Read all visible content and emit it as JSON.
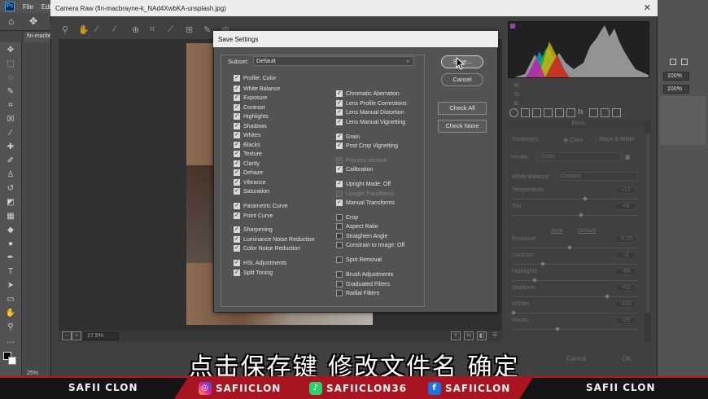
{
  "ps": {
    "menu": [
      "File",
      "Edit"
    ],
    "doc_tab": "fin-macbr",
    "zoom": "25%",
    "right_panel": {
      "zoom1": "100%",
      "zoom2": "100%"
    }
  },
  "camera_raw": {
    "title": "Camera Raw (fin-macbrayne-k_NAd4XwbKA-unsplash.jpg)",
    "zoom_select": "17.5%",
    "rgb_labels": [
      "R:",
      "G:",
      "B:"
    ],
    "panel_title": "Basic",
    "treatment_label": "Treatment:",
    "treatment_options": [
      "Color",
      "Black & White"
    ],
    "profile_label": "Profile:",
    "profile_value": "Color",
    "white_balance_label": "White Balance:",
    "white_balance_value": "Custom",
    "sliders": [
      {
        "label": "Temperature",
        "value": "+17",
        "level": 0.58
      },
      {
        "label": "Tint",
        "value": "+9",
        "level": 0.55
      },
      {
        "label": "Exposure",
        "value": "-0.25",
        "level": 0.46
      },
      {
        "label": "Contrast",
        "value": "-3",
        "level": 0.24
      },
      {
        "label": "Highlights",
        "value": "-66",
        "level": 0.17
      },
      {
        "label": "Shadows",
        "value": "+52",
        "level": 0.76
      },
      {
        "label": "Whites",
        "value": "-100",
        "level": 0.0
      },
      {
        "label": "Blacks",
        "value": "-29",
        "level": 0.36
      }
    ],
    "auto_label": "Auto",
    "default_label": "Default",
    "cancel_label": "Cancel",
    "ok_label": "OK"
  },
  "dialog": {
    "title": "Save Settings",
    "subset_label": "Subset:",
    "subset_value": "Default",
    "buttons": {
      "save": "Save...",
      "cancel": "Cancel",
      "check_all": "Check All",
      "check_none": "Check None"
    },
    "left_col": [
      {
        "label": "Profile: Color",
        "checked": true
      },
      {
        "label": "White Balance",
        "checked": true
      },
      {
        "label": "Exposure",
        "checked": true
      },
      {
        "label": "Contrast",
        "checked": true
      },
      {
        "label": "Highlights",
        "checked": true
      },
      {
        "label": "Shadows",
        "checked": true
      },
      {
        "label": "Whites",
        "checked": true
      },
      {
        "label": "Blacks",
        "checked": true
      },
      {
        "label": "Texture",
        "checked": true
      },
      {
        "label": "Clarity",
        "checked": true
      },
      {
        "label": "Dehaze",
        "checked": true
      },
      {
        "label": "Vibrance",
        "checked": true
      },
      {
        "label": "Saturation",
        "checked": true
      },
      {
        "label": "Parametric Curve",
        "checked": true
      },
      {
        "label": "Point Curve",
        "checked": true
      },
      {
        "label": "Sharpening",
        "checked": true
      },
      {
        "label": "Luminance Noise Reduction",
        "checked": true
      },
      {
        "label": "Color Noise Reduction",
        "checked": true
      },
      {
        "label": "HSL Adjustments",
        "checked": true
      },
      {
        "label": "Split Toning",
        "checked": true
      }
    ],
    "right_col": [
      {
        "label": "Chromatic Aberration",
        "checked": true,
        "disabled": false
      },
      {
        "label": "Lens Profile Corrections",
        "checked": true,
        "disabled": false
      },
      {
        "label": "Lens Manual Distortion",
        "checked": true,
        "disabled": false
      },
      {
        "label": "Lens Manual Vignetting",
        "checked": true,
        "disabled": false
      },
      {
        "label": "Grain",
        "checked": true,
        "disabled": false
      },
      {
        "label": "Post Crop Vignetting",
        "checked": true,
        "disabled": false
      },
      {
        "label": "Process Version",
        "checked": true,
        "disabled": true
      },
      {
        "label": "Calibration",
        "checked": true,
        "disabled": false
      },
      {
        "label": "Upright Mode: Off",
        "checked": true,
        "disabled": false
      },
      {
        "label": "Upright Transforms",
        "checked": false,
        "disabled": true
      },
      {
        "label": "Manual Transforms",
        "checked": true,
        "disabled": false
      },
      {
        "label": "Crop",
        "checked": false,
        "disabled": false
      },
      {
        "label": "Aspect Ratio",
        "checked": false,
        "disabled": false
      },
      {
        "label": "Straighten Angle",
        "checked": false,
        "disabled": false
      },
      {
        "label": "Constrain to Image: Off",
        "checked": false,
        "disabled": false
      },
      {
        "label": "Spot Removal",
        "checked": false,
        "disabled": false
      },
      {
        "label": "Brush Adjustments",
        "checked": false,
        "disabled": false
      },
      {
        "label": "Graduated Filters",
        "checked": false,
        "disabled": false
      },
      {
        "label": "Radial Filters",
        "checked": false,
        "disabled": false
      }
    ]
  },
  "subtitle": "点击保存键 修改文件名 确定",
  "banner": {
    "left": "SAFII CLON",
    "instagram": "SAFIICLON",
    "tiktok": "SAFIICLON36",
    "facebook": "SAFIICLON",
    "right": "SAFII CLON",
    "accent": "#a8141f"
  }
}
